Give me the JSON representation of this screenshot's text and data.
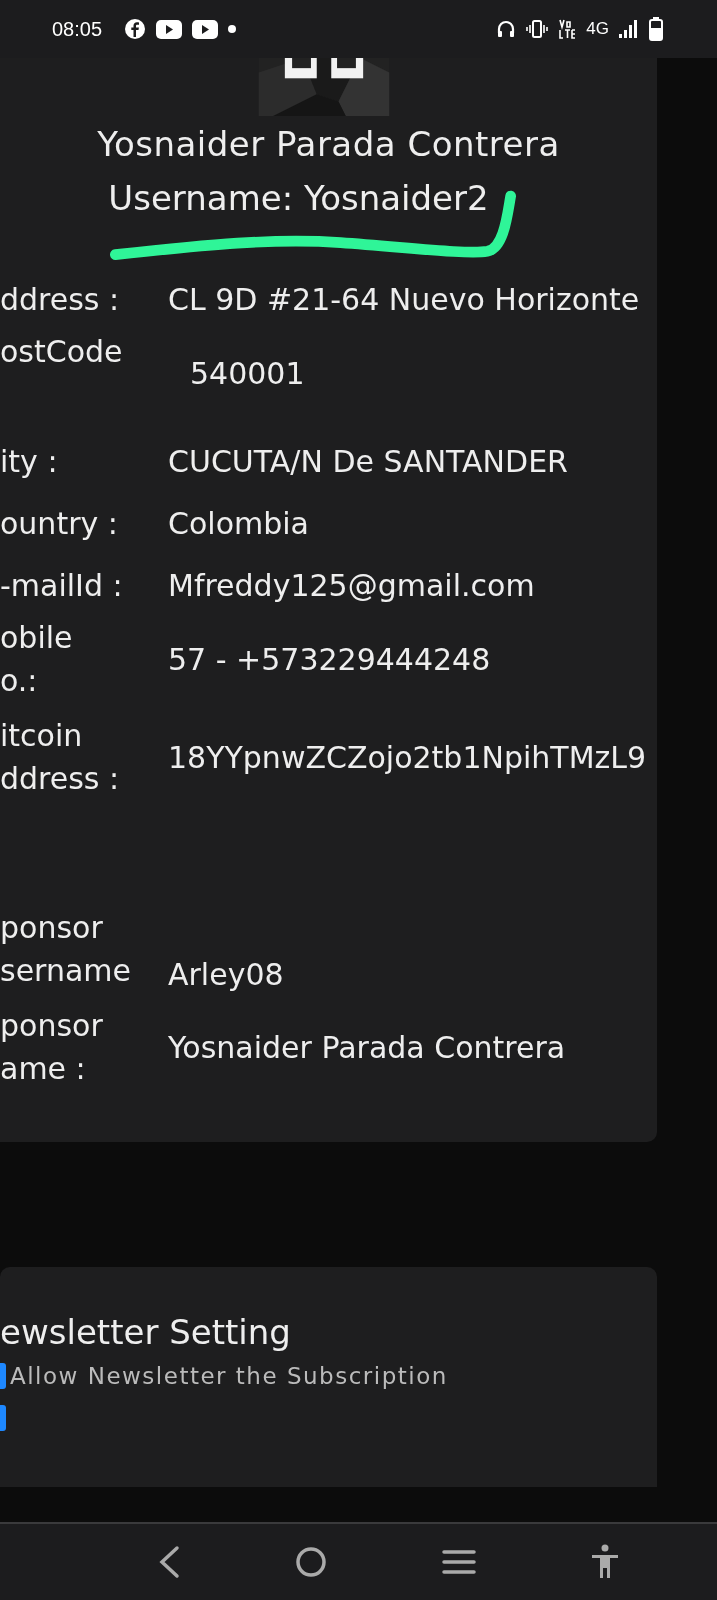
{
  "status_bar": {
    "time": "08:05",
    "network": "4G"
  },
  "profile": {
    "name": "Yosnaider Parada Contrera",
    "username": "Username: Yosnaider2"
  },
  "details": [
    {
      "label": "ddress :",
      "value": "CL 9D #21-64 Nuevo Horizonte"
    },
    {
      "label": "ostCode",
      "value": "540001",
      "kind": "offset"
    },
    {
      "label": "ity :",
      "value": "CUCUTA/N De SANTANDER"
    },
    {
      "label": "ountry :",
      "value": "Colombia"
    },
    {
      "label": "-mailId :",
      "value": "Mfreddy125@gmail.com"
    },
    {
      "label": "obile\no.:",
      "value": "57 - +573229444248"
    },
    {
      "label": "itcoin\nddress :",
      "value": "18YYpnwZCZojo2tb1NpihTMzL9"
    },
    {
      "label": "ponsor\nsername",
      "value": "Arley08",
      "kind": "bottom"
    },
    {
      "label": "ponsor\name :",
      "value": "Yosnaider Parada Contrera"
    }
  ],
  "newsletter": {
    "title": "ewsletter Setting",
    "options": [
      {
        "label": "Allow Newsletter the Subscription",
        "checked": true
      },
      {
        "checked": true
      }
    ]
  }
}
